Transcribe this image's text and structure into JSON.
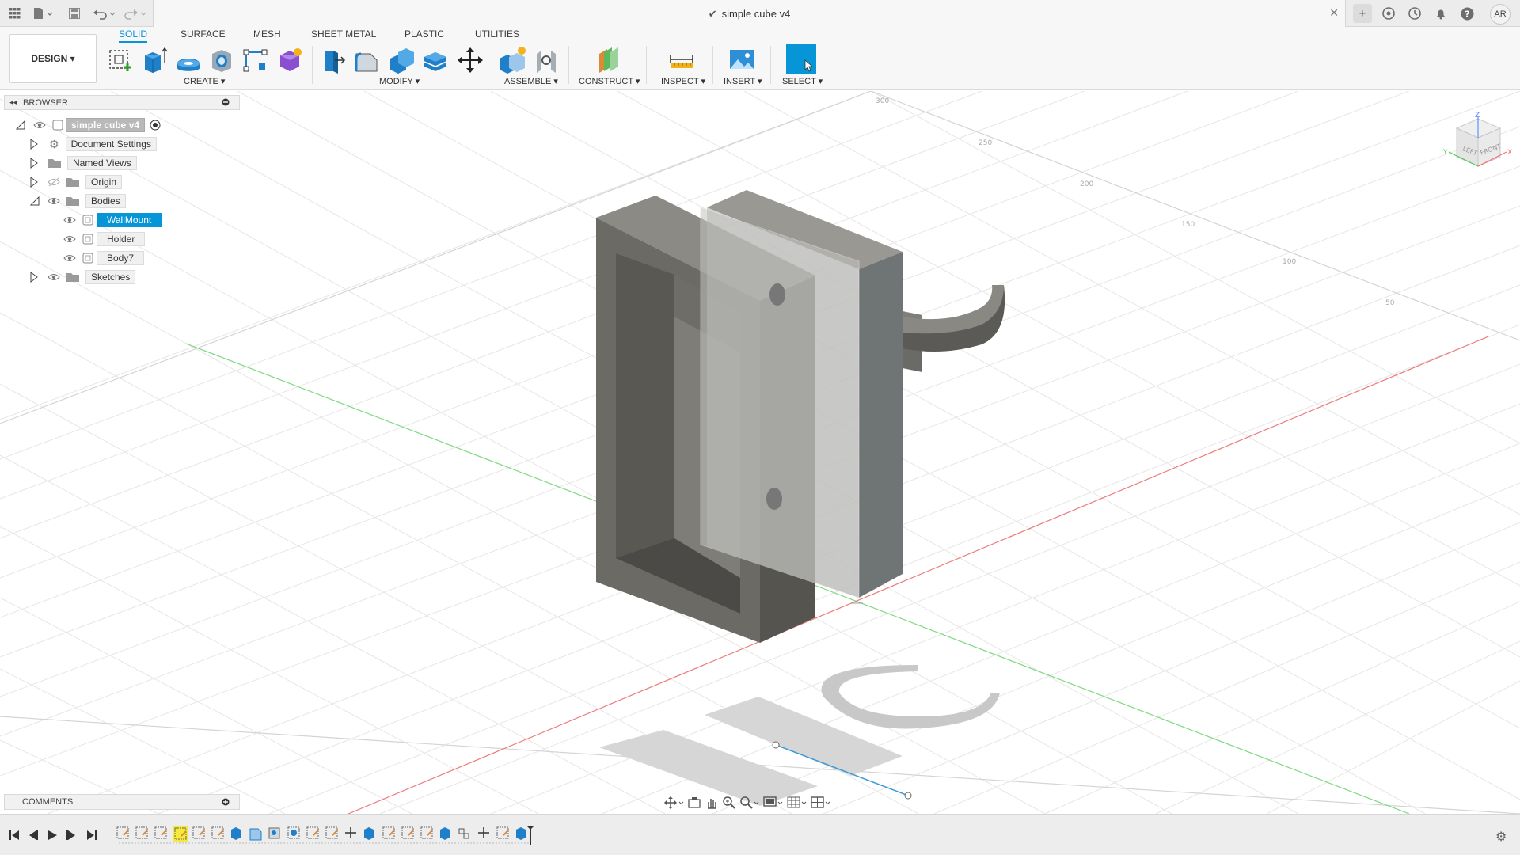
{
  "app": {
    "document_title": "simple cube v4",
    "user_initials": "AR"
  },
  "toolbar": {
    "workspace_label": "DESIGN",
    "tabs": [
      "SOLID",
      "SURFACE",
      "MESH",
      "SHEET METAL",
      "PLASTIC",
      "UTILITIES"
    ],
    "active_tab": "SOLID",
    "groups": [
      "CREATE",
      "MODIFY",
      "ASSEMBLE",
      "CONSTRUCT",
      "INSPECT",
      "INSERT",
      "SELECT"
    ]
  },
  "browser": {
    "header": "BROWSER",
    "root": "simple cube v4",
    "items": [
      {
        "label": "Document Settings",
        "icon": "gear-icon"
      },
      {
        "label": "Named Views",
        "icon": "folder-icon"
      },
      {
        "label": "Origin",
        "icon": "folder-icon"
      },
      {
        "label": "Bodies",
        "icon": "folder-icon"
      },
      {
        "label": "WallMount",
        "icon": "body-icon",
        "selected": true
      },
      {
        "label": "Holder",
        "icon": "body-icon"
      },
      {
        "label": "Body7",
        "icon": "body-icon"
      },
      {
        "label": "Sketches",
        "icon": "folder-icon"
      }
    ]
  },
  "comments": {
    "label": "COMMENTS"
  },
  "axis_labels": [
    "300",
    "250",
    "200",
    "150",
    "100",
    "50"
  ],
  "viewcube": {
    "top": "Z",
    "left_face": "LEFT",
    "front_face": "FRONT",
    "x_axis": "X",
    "y_axis": "Y"
  },
  "colors": {
    "accent": "#0696d7",
    "grid_x_axis": "#e24a4a",
    "grid_y_axis": "#4ccc4c"
  }
}
